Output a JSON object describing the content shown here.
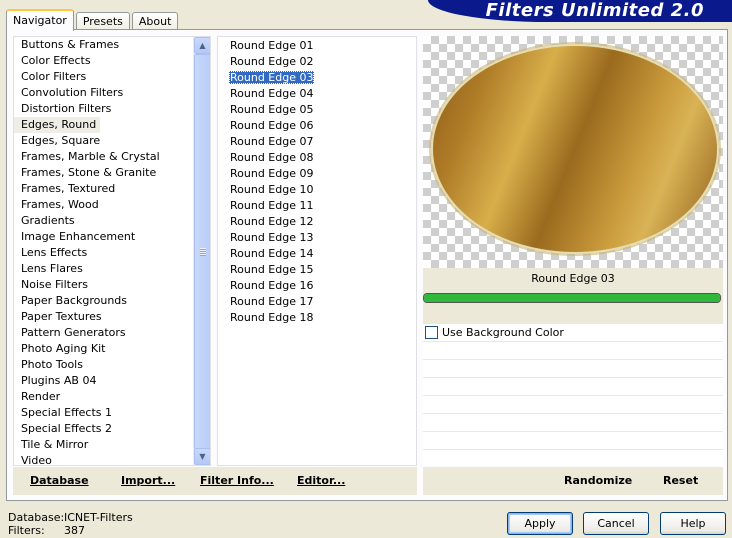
{
  "window": {
    "banner_title": "Filters Unlimited 2.0"
  },
  "tabs": [
    {
      "label": "Navigator",
      "active": true
    },
    {
      "label": "Presets",
      "active": false
    },
    {
      "label": "About",
      "active": false
    }
  ],
  "categories": {
    "items": [
      "Buttons & Frames",
      "Color Effects",
      "Color Filters",
      "Convolution Filters",
      "Distortion Filters",
      "Edges, Round",
      "Edges, Square",
      "Frames, Marble & Crystal",
      "Frames, Stone & Granite",
      "Frames, Textured",
      "Frames, Wood",
      "Gradients",
      "Image Enhancement",
      "Lens Effects",
      "Lens Flares",
      "Noise Filters",
      "Paper Backgrounds",
      "Paper Textures",
      "Pattern Generators",
      "Photo Aging Kit",
      "Photo Tools",
      "Plugins AB 04",
      "Render",
      "Special Effects 1",
      "Special Effects 2",
      "Tile & Mirror",
      "Video"
    ],
    "selected": "Edges, Round"
  },
  "filters": {
    "items": [
      "Round Edge 01",
      "Round Edge 02",
      "Round Edge 03",
      "Round Edge 04",
      "Round Edge 05",
      "Round Edge 06",
      "Round Edge 07",
      "Round Edge 08",
      "Round Edge 09",
      "Round Edge 10",
      "Round Edge 11",
      "Round Edge 12",
      "Round Edge 13",
      "Round Edge 14",
      "Round Edge 15",
      "Round Edge 16",
      "Round Edge 17",
      "Round Edge 18"
    ],
    "selected": "Round Edge 03"
  },
  "preview": {
    "label": "Round Edge 03",
    "progress": 1.0
  },
  "options": {
    "use_background_color_label": "Use Background Color",
    "use_background_color_checked": false
  },
  "link_buttons": {
    "database": "Database",
    "import": "Import...",
    "filter_info": "Filter Info...",
    "editor": "Editor...",
    "randomize": "Randomize",
    "reset": "Reset"
  },
  "status": {
    "database_label": "Database:",
    "database_value": "ICNET-Filters",
    "filters_label": "Filters:",
    "filters_value": "387"
  },
  "dialog_buttons": {
    "apply": "Apply",
    "cancel": "Cancel",
    "help": "Help"
  },
  "icons": {
    "scroll_up": "scroll-up-arrow-icon",
    "scroll_down": "scroll-down-arrow-icon"
  }
}
